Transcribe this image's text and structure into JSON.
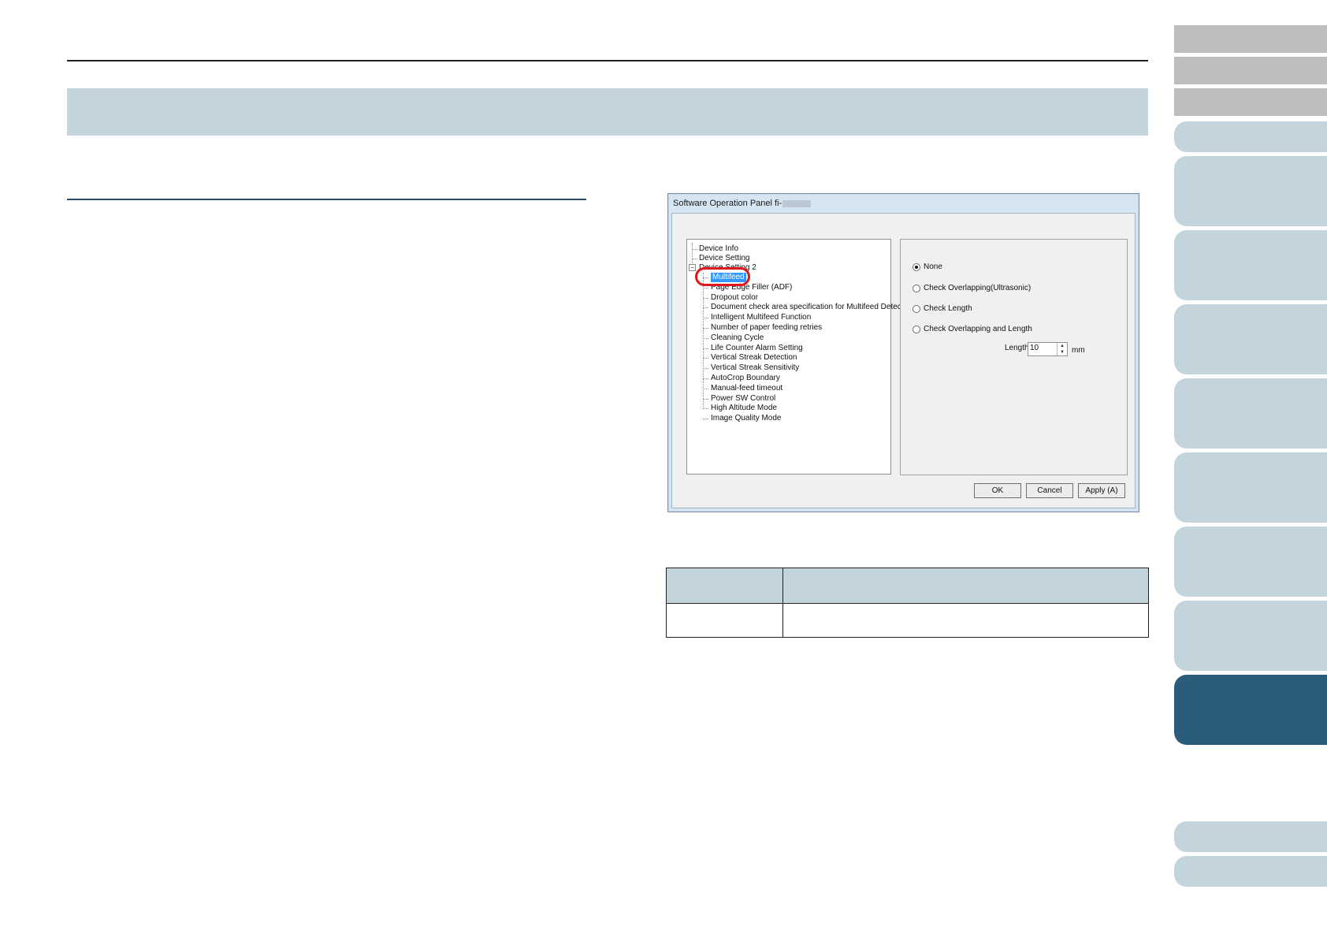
{
  "dialog": {
    "title": "Software Operation Panel fi-",
    "tree": {
      "items": [
        "Device Info",
        "Device Setting",
        "Device Setting 2"
      ],
      "children": [
        "Multifeed",
        "Page Edge Filler (ADF)",
        "Dropout color",
        "Document check area specification for Multifeed Detection",
        "Intelligent Multifeed Function",
        "Number of paper feeding retries",
        "Cleaning Cycle",
        "Life Counter Alarm Setting",
        "Vertical Streak Detection",
        "Vertical Streak Sensitivity",
        "AutoCrop Boundary",
        "Manual-feed timeout",
        "Power SW Control",
        "High Altitude Mode",
        "Image Quality Mode"
      ],
      "selected": "Multifeed",
      "expander": "−"
    },
    "options": {
      "radios": [
        {
          "label": "None",
          "checked": true
        },
        {
          "label": "Check Overlapping(Ultrasonic)",
          "checked": false
        },
        {
          "label": "Check Length",
          "checked": false
        },
        {
          "label": "Check Overlapping and Length",
          "checked": false
        }
      ],
      "length_label": "Length",
      "length_value": "10",
      "length_unit": "mm"
    },
    "buttons": {
      "ok": "OK",
      "cancel": "Cancel",
      "apply": "Apply (A)"
    }
  },
  "colors": {
    "band": "#c3d4dd",
    "tab_light": "#c3d4dd",
    "tab_dark": "#2b5c7c",
    "tab_grey": "#bdbdbd",
    "highlight_oval": "#e1141b",
    "selection": "#3399ff"
  }
}
